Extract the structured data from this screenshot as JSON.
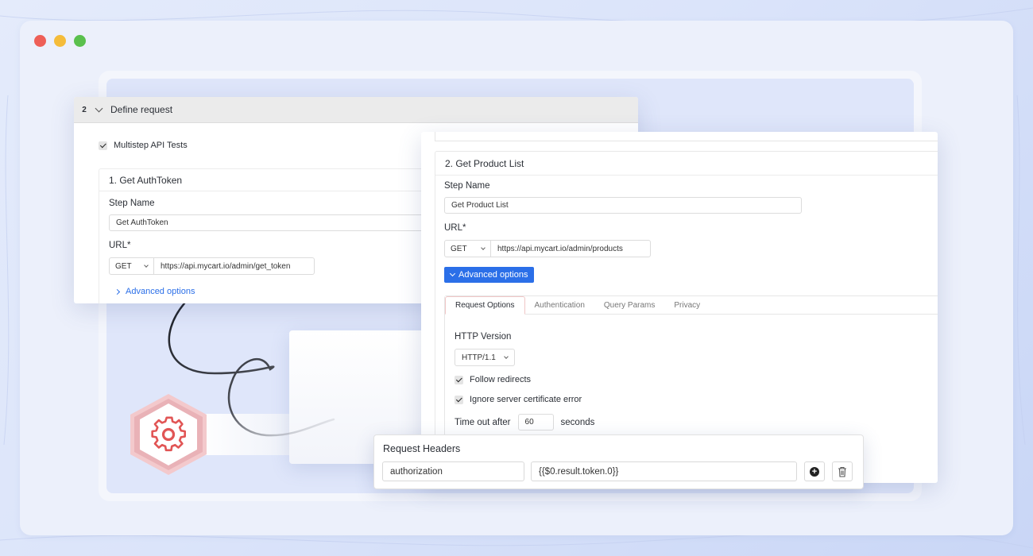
{
  "window": {
    "controls": [
      "close",
      "minimize",
      "maximize"
    ]
  },
  "define_request": {
    "step_number": "2",
    "title": "Define request",
    "multistep_label": "Multistep API Tests",
    "multistep_checked": true,
    "step1": {
      "title": "1. Get AuthToken",
      "step_name_label": "Step Name",
      "step_name_value": "Get AuthToken",
      "url_label": "URL*",
      "method": "GET",
      "url_value": "https://api.mycart.io/admin/get_token",
      "advanced_label": "Advanced options"
    }
  },
  "step2": {
    "title": "2. Get Product List",
    "step_name_label": "Step Name",
    "step_name_value": "Get Product List",
    "url_label": "URL*",
    "method": "GET",
    "url_value": "https://api.mycart.io/admin/products",
    "advanced_label": "Advanced options",
    "tabs": [
      "Request Options",
      "Authentication",
      "Query Params",
      "Privacy"
    ],
    "active_tab": "Request Options",
    "http_version_label": "HTTP Version",
    "http_version_value": "HTTP/1.1",
    "follow_redirects_label": "Follow redirects",
    "follow_redirects_checked": true,
    "ignore_cert_label": "Ignore server certificate error",
    "ignore_cert_checked": true,
    "timeout_label": "Time out after",
    "timeout_value": "60",
    "timeout_unit": "seconds"
  },
  "request_headers": {
    "title": "Request Headers",
    "header_name": "authorization",
    "header_value": "{{$0.result.token.0}}"
  },
  "icons": {
    "gear": "gear-icon",
    "add": "plus-circle-icon",
    "delete": "trash-icon"
  },
  "colors": {
    "accent": "#2b6fe8",
    "gear_hex": "#e15555",
    "close_dot": "#ee5f57",
    "minimize_dot": "#f5bc3a",
    "maximize_dot": "#5ac04d"
  }
}
